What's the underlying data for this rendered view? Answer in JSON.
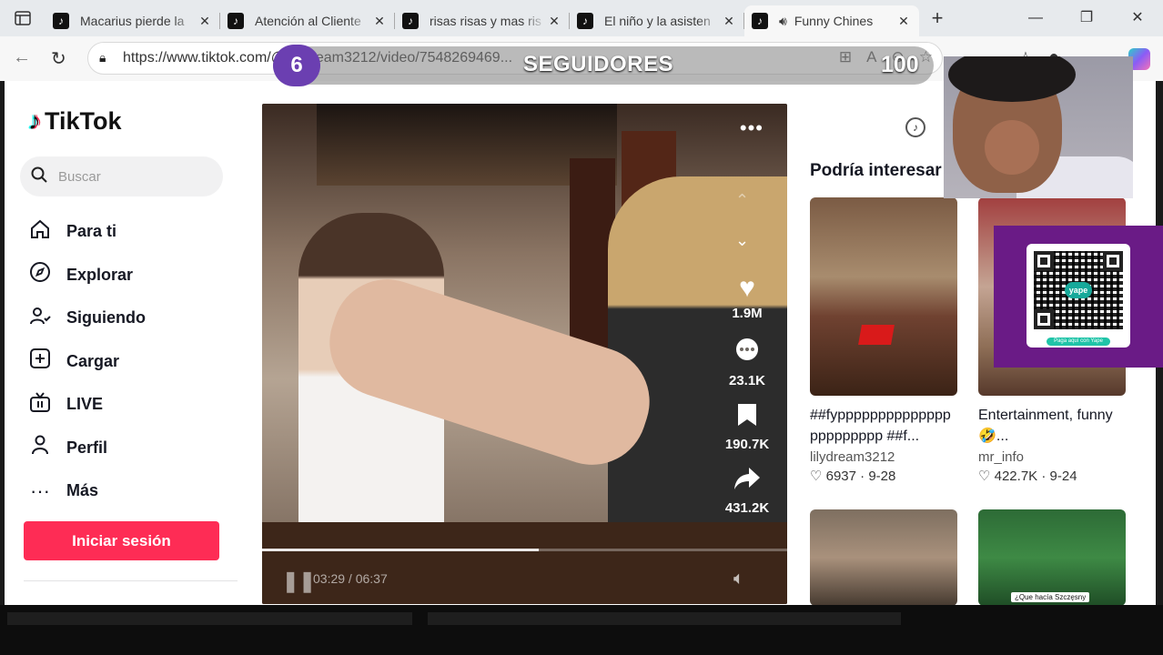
{
  "browser": {
    "tabs": [
      {
        "title": "Macarius pierde la",
        "active": false,
        "audio": false
      },
      {
        "title": "Atención al Cliente",
        "active": false,
        "audio": false
      },
      {
        "title": "risas risas y mas ris",
        "active": false,
        "audio": false
      },
      {
        "title": "El niño y la asisten",
        "active": false,
        "audio": false
      },
      {
        "title": "Funny Chines",
        "active": true,
        "audio": true
      }
    ],
    "url": "https://www.tiktok.com/@lilydream3212/video/7548269469..."
  },
  "sidebar": {
    "logo": "TikTok",
    "search_placeholder": "Buscar",
    "items": [
      {
        "label": "Para ti",
        "icon": "home-icon"
      },
      {
        "label": "Explorar",
        "icon": "compass-icon"
      },
      {
        "label": "Siguiendo",
        "icon": "following-icon"
      },
      {
        "label": "Cargar",
        "icon": "upload-icon"
      },
      {
        "label": "LIVE",
        "icon": "live-tv-icon"
      },
      {
        "label": "Perfil",
        "icon": "profile-icon"
      },
      {
        "label": "Más",
        "icon": "more-dots-icon"
      }
    ],
    "login_label": "Iniciar sesión",
    "login_color": "#fe2c55"
  },
  "video": {
    "likes": "1.9M",
    "comments": "23.1K",
    "saves": "190.7K",
    "shares": "431.2K",
    "current_time": "03:29",
    "duration": "06:37",
    "time_display": "03:29 / 06:37",
    "progress": 0.527
  },
  "related": {
    "title": "Podría interesar",
    "cards": [
      {
        "desc": "##fyppppppppppppppppppppppp ##f...",
        "author": "lilydream3212",
        "likes": "6937",
        "date": "9-28"
      },
      {
        "desc": "Entertainment, funny 🤣...",
        "author": "mr_info",
        "likes": "422.7K",
        "date": "9-24"
      },
      {
        "desc": "",
        "author": "",
        "likes": "",
        "date": ""
      },
      {
        "desc": "",
        "author": "",
        "likes": "",
        "date": "",
        "caption": "¿Que hacía Szczęsny"
      }
    ]
  },
  "overlay": {
    "followers_count": "6",
    "followers_label": "SEGUIDORES",
    "followers_goal": "100",
    "qr_badge": "yape",
    "qr_caption": "Paga aquí con Yape",
    "accent": "#6b3fb1"
  }
}
